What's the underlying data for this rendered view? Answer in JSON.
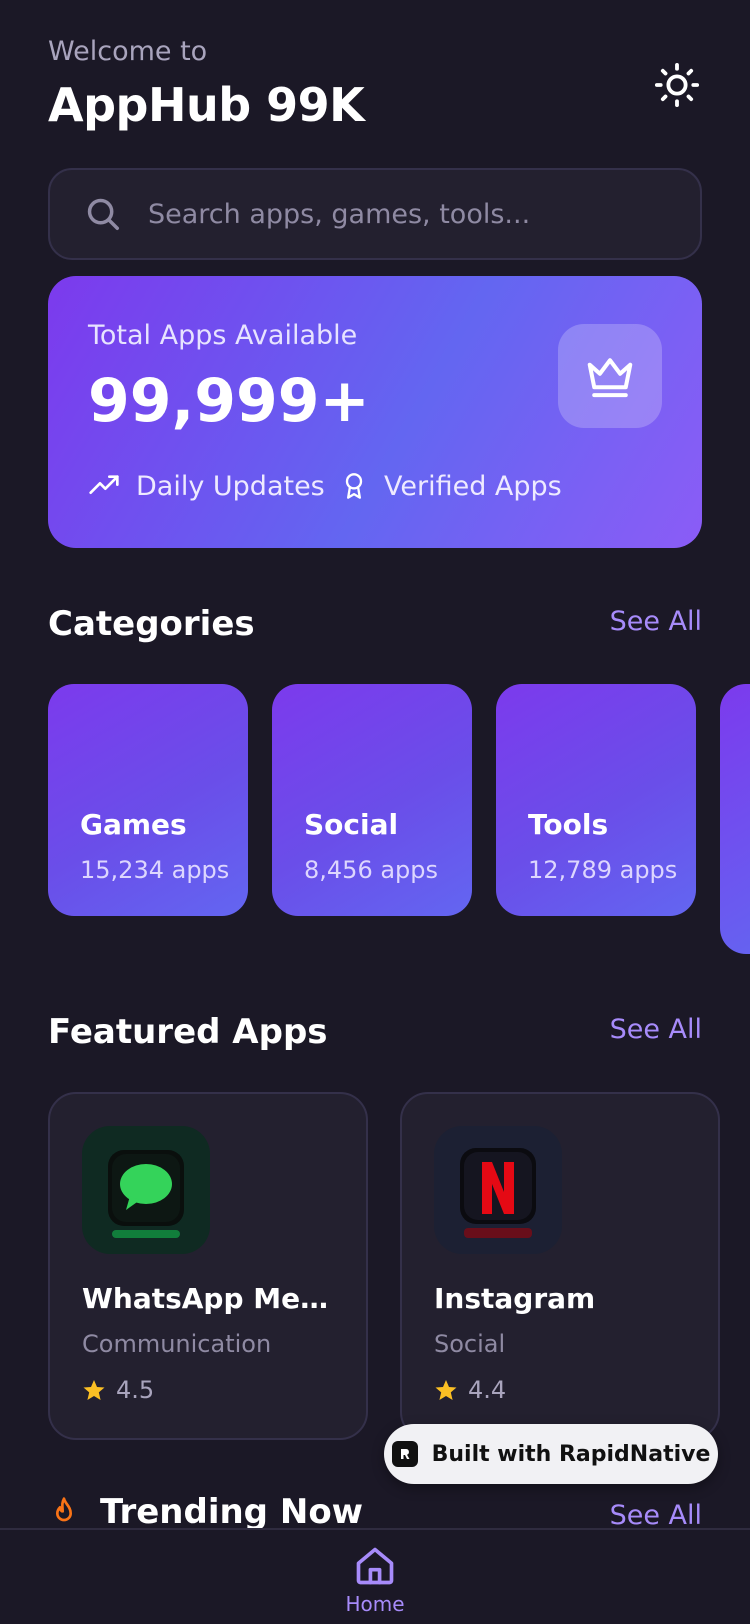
{
  "header": {
    "welcome": "Welcome to",
    "title": "AppHub 99K",
    "theme_icon": "sun-icon"
  },
  "search": {
    "placeholder": "Search apps, games, tools..."
  },
  "hero": {
    "label": "Total Apps Available",
    "count": "99,999+",
    "features": [
      "Daily Updates",
      "Verified Apps"
    ]
  },
  "categories": {
    "title": "Categories",
    "see_all": "See All",
    "items": [
      {
        "name": "Games",
        "count": "15,234 apps"
      },
      {
        "name": "Social",
        "count": "8,456 apps"
      },
      {
        "name": "Tools",
        "count": "12,789 apps"
      }
    ]
  },
  "featured": {
    "title": "Featured Apps",
    "see_all": "See All",
    "items": [
      {
        "name": "WhatsApp Messenger",
        "category": "Communication",
        "rating": "4.5"
      },
      {
        "name": "Instagram",
        "category": "Social",
        "rating": "4.4"
      }
    ]
  },
  "badge": {
    "label": "Built with RapidNative"
  },
  "trending": {
    "title": "Trending Now",
    "see_all": "See All"
  },
  "tabbar": {
    "home": "Home"
  },
  "colors": {
    "accent": "#a78bfa",
    "background": "#1b1826",
    "card": "#23202f",
    "star": "#fbbf24"
  }
}
